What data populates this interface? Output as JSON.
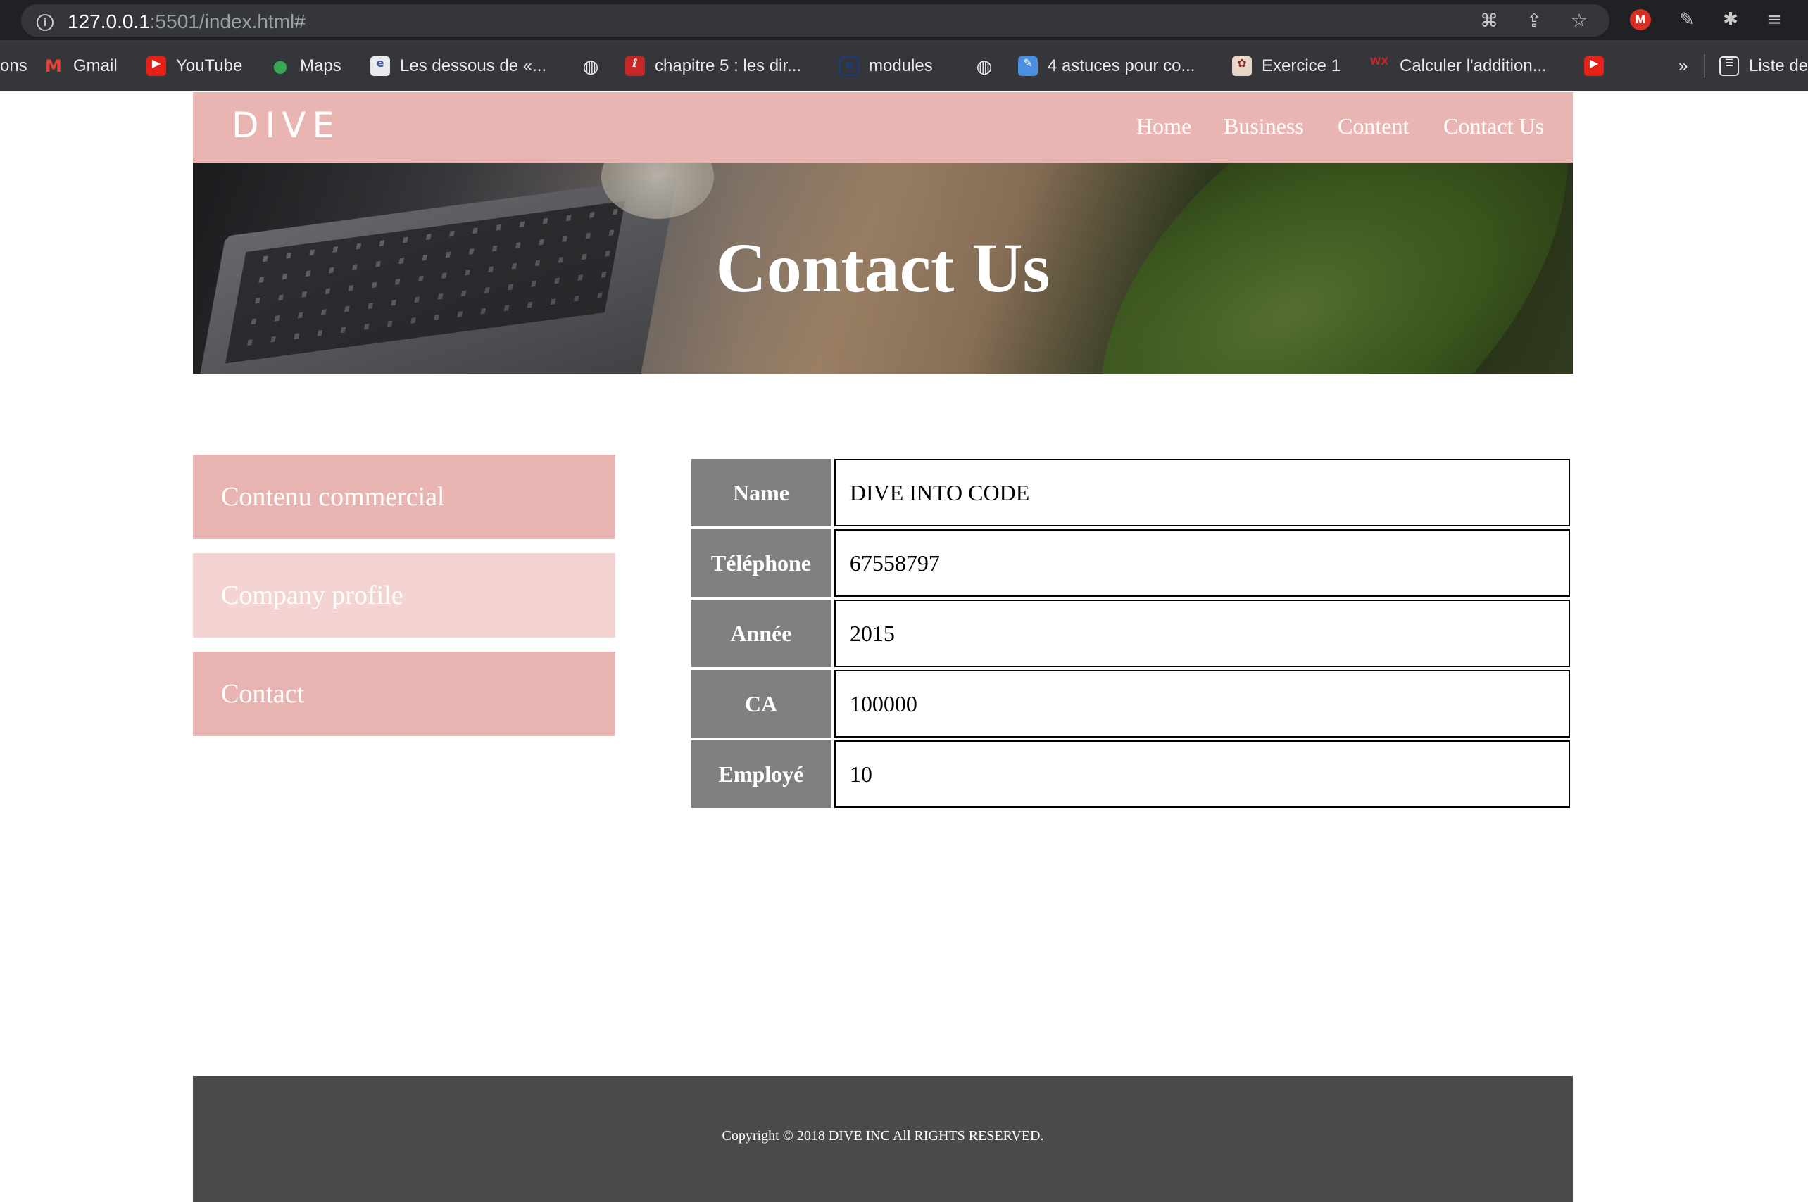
{
  "browser": {
    "url_host": "127.0.0.1",
    "url_rest": ":5501/index.html#",
    "bookmarks": [
      {
        "label": "ons"
      },
      {
        "label": "Gmail"
      },
      {
        "label": "YouTube"
      },
      {
        "label": "Maps"
      },
      {
        "label": "Les dessous de «..."
      },
      {
        "label": ""
      },
      {
        "label": "chapitre 5 : les dir..."
      },
      {
        "label": "modules"
      },
      {
        "label": ""
      },
      {
        "label": "4 astuces pour co..."
      },
      {
        "label": "Exercice 1"
      },
      {
        "label": "Calculer l'addition..."
      },
      {
        "label": ""
      },
      {
        "label": "»"
      },
      {
        "label": "Liste de"
      }
    ],
    "ext_m_label": "M"
  },
  "site": {
    "logo": "DIVE",
    "nav": [
      "Home",
      "Business",
      "Content",
      "Contact Us"
    ],
    "hero_title": "Contact Us",
    "side_menu": [
      "Contenu commercial",
      "Company profile",
      "Contact"
    ],
    "table": [
      {
        "label": "Name",
        "value": "DIVE INTO CODE"
      },
      {
        "label": "Téléphone",
        "value": "67558797"
      },
      {
        "label": "Année",
        "value": "2015"
      },
      {
        "label": "CA",
        "value": "100000"
      },
      {
        "label": "Employé",
        "value": "10"
      }
    ],
    "footer": "Copyright © 2018 DIVE INC All RIGHTS RESERVED."
  },
  "colors": {
    "header_pink": "#e9b5b2",
    "menu_pink": "#e9b5b2",
    "menu_pink_light": "#f3d4d3",
    "table_header_gray": "#808080",
    "footer_gray": "#4a4a4a"
  }
}
